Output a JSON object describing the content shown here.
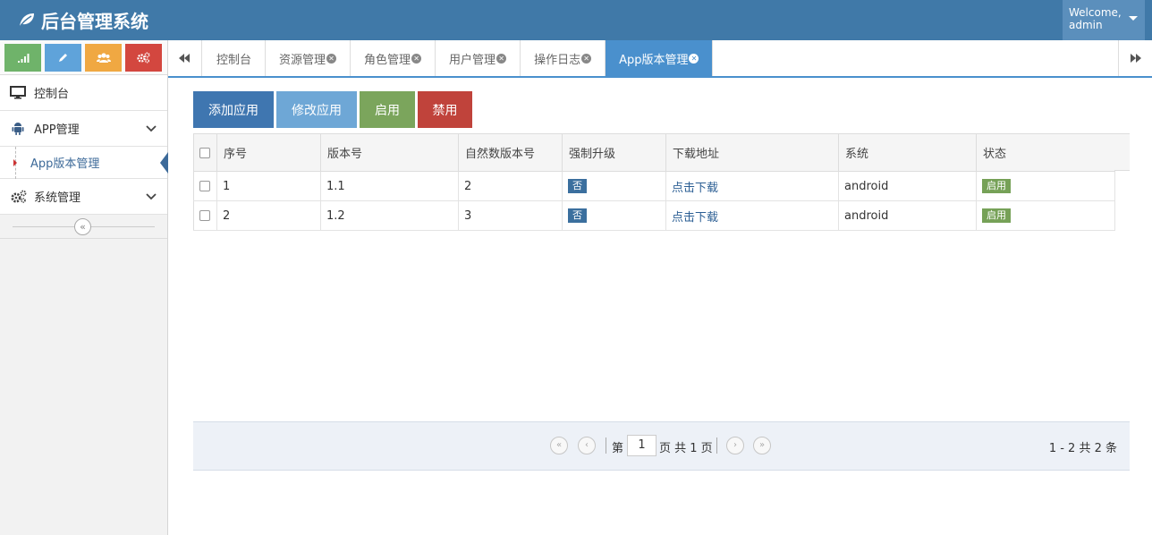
{
  "header": {
    "title": "后台管理系统",
    "welcome_line1": "Welcome,",
    "welcome_line2": "admin"
  },
  "shortcuts": [
    {
      "icon": "signal-icon",
      "color": "#6fb36a"
    },
    {
      "icon": "pencil-icon",
      "color": "#5fa3da"
    },
    {
      "icon": "users-icon",
      "color": "#f0a842"
    },
    {
      "icon": "gears-icon",
      "color": "#d3473f"
    }
  ],
  "sidebar": {
    "dashboard": "控制台",
    "app_mgmt": "APP管理",
    "app_version": "App版本管理",
    "system_mgmt": "系统管理"
  },
  "tabs": [
    {
      "label": "控制台",
      "closable": false
    },
    {
      "label": "资源管理",
      "closable": true
    },
    {
      "label": "角色管理",
      "closable": true
    },
    {
      "label": "用户管理",
      "closable": true
    },
    {
      "label": "操作日志",
      "closable": true
    },
    {
      "label": "App版本管理",
      "closable": true,
      "active": true
    }
  ],
  "toolbar": {
    "add": "添加应用",
    "edit": "修改应用",
    "enable": "启用",
    "disable": "禁用"
  },
  "table": {
    "columns": [
      "序号",
      "版本号",
      "自然数版本号",
      "强制升级",
      "下载地址",
      "系统",
      "状态"
    ],
    "rows": [
      {
        "id": "1",
        "version": "1.1",
        "natural": "2",
        "force": "否",
        "download": "点击下载",
        "os": "android",
        "status": "启用"
      },
      {
        "id": "2",
        "version": "1.2",
        "natural": "3",
        "force": "否",
        "download": "点击下载",
        "os": "android",
        "status": "启用"
      }
    ]
  },
  "pager": {
    "page_prefix": "第",
    "page_value": "1",
    "page_suffix": "页 共 1 页",
    "info": "1 - 2 共 2 条"
  }
}
